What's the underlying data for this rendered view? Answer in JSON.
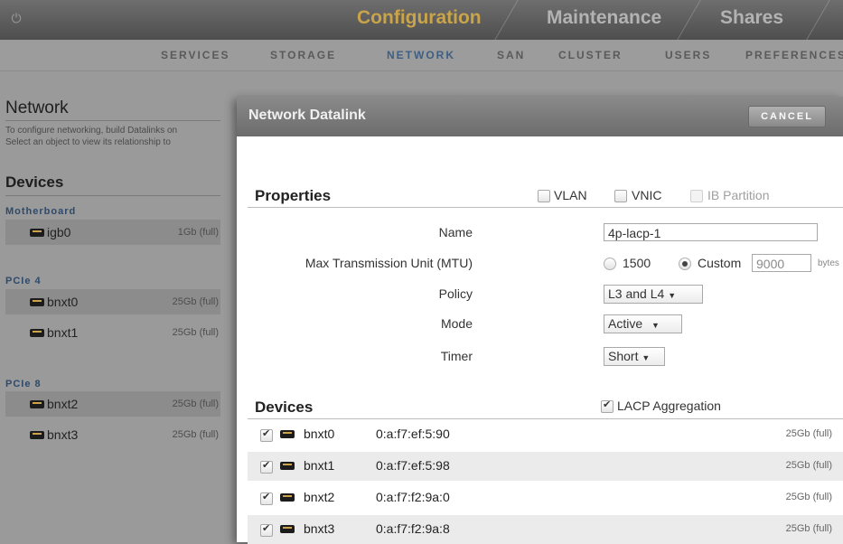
{
  "header": {
    "tabs": [
      "Configuration",
      "Maintenance",
      "Shares"
    ],
    "active_tab": "Configuration"
  },
  "subnav": {
    "items": [
      "SERVICES",
      "STORAGE",
      "NETWORK",
      "SAN",
      "CLUSTER",
      "USERS",
      "PREFERENCES"
    ],
    "active": "NETWORK"
  },
  "left": {
    "title": "Network",
    "intro_line1": "To configure networking, build Datalinks on",
    "intro_line2": "Select an object to view its relationship to",
    "devices_heading": "Devices",
    "groups": [
      {
        "label": "Motherboard",
        "devices": [
          {
            "name": "igb0",
            "speed": "1Gb (full)"
          }
        ]
      },
      {
        "label": "PCIe 4",
        "devices": [
          {
            "name": "bnxt0",
            "speed": "25Gb (full)"
          },
          {
            "name": "bnxt1",
            "speed": "25Gb (full)"
          }
        ]
      },
      {
        "label": "PCIe 8",
        "devices": [
          {
            "name": "bnxt2",
            "speed": "25Gb (full)"
          },
          {
            "name": "bnxt3",
            "speed": "25Gb (full)"
          }
        ]
      }
    ]
  },
  "dialog": {
    "title": "Network Datalink",
    "cancel_label": "CANCEL",
    "properties_heading": "Properties",
    "options": {
      "vlan": "VLAN",
      "vnic": "VNIC",
      "ib_partition": "IB Partition"
    },
    "fields": {
      "name_label": "Name",
      "name_value": "4p-lacp-1",
      "mtu_label": "Max Transmission Unit (MTU)",
      "mtu_option_default": "1500",
      "mtu_option_custom": "Custom",
      "mtu_value": "9000",
      "mtu_unit": "bytes",
      "policy_label": "Policy",
      "policy_value": "L3 and L4",
      "mode_label": "Mode",
      "mode_value": "Active",
      "timer_label": "Timer",
      "timer_value": "Short"
    },
    "devices_heading": "Devices",
    "lacp_label": "LACP Aggregation",
    "devices": [
      {
        "name": "bnxt0",
        "mac": "0:a:f7:ef:5:90",
        "speed": "25Gb (full)"
      },
      {
        "name": "bnxt1",
        "mac": "0:a:f7:ef:5:98",
        "speed": "25Gb (full)"
      },
      {
        "name": "bnxt2",
        "mac": "0:a:f7:f2:9a:0",
        "speed": "25Gb (full)"
      },
      {
        "name": "bnxt3",
        "mac": "0:a:f7:f2:9a:8",
        "speed": "25Gb (full)"
      }
    ]
  }
}
